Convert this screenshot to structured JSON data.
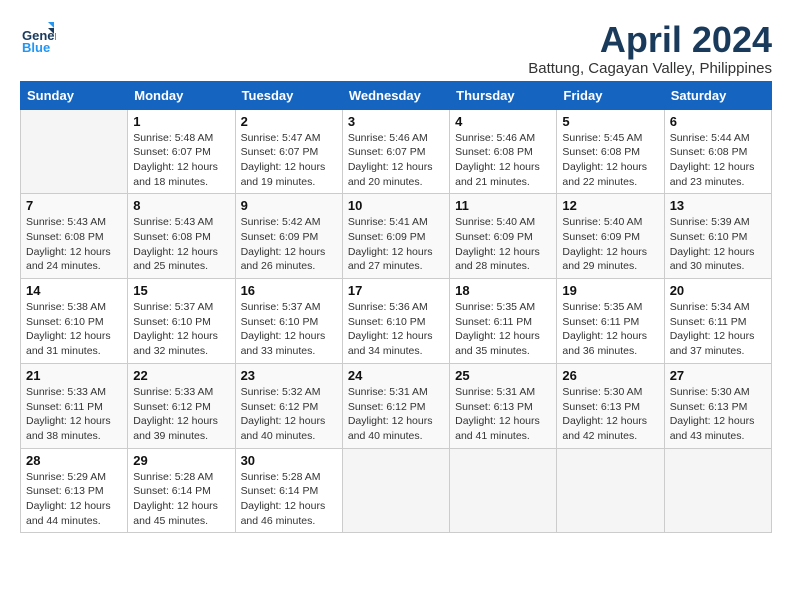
{
  "header": {
    "logo_general": "General",
    "logo_blue": "Blue",
    "month_title": "April 2024",
    "location": "Battung, Cagayan Valley, Philippines"
  },
  "days_of_week": [
    "Sunday",
    "Monday",
    "Tuesday",
    "Wednesday",
    "Thursday",
    "Friday",
    "Saturday"
  ],
  "weeks": [
    [
      {
        "day": "",
        "sunrise": "",
        "sunset": "",
        "daylight": ""
      },
      {
        "day": "1",
        "sunrise": "Sunrise: 5:48 AM",
        "sunset": "Sunset: 6:07 PM",
        "daylight": "Daylight: 12 hours and 18 minutes."
      },
      {
        "day": "2",
        "sunrise": "Sunrise: 5:47 AM",
        "sunset": "Sunset: 6:07 PM",
        "daylight": "Daylight: 12 hours and 19 minutes."
      },
      {
        "day": "3",
        "sunrise": "Sunrise: 5:46 AM",
        "sunset": "Sunset: 6:07 PM",
        "daylight": "Daylight: 12 hours and 20 minutes."
      },
      {
        "day": "4",
        "sunrise": "Sunrise: 5:46 AM",
        "sunset": "Sunset: 6:08 PM",
        "daylight": "Daylight: 12 hours and 21 minutes."
      },
      {
        "day": "5",
        "sunrise": "Sunrise: 5:45 AM",
        "sunset": "Sunset: 6:08 PM",
        "daylight": "Daylight: 12 hours and 22 minutes."
      },
      {
        "day": "6",
        "sunrise": "Sunrise: 5:44 AM",
        "sunset": "Sunset: 6:08 PM",
        "daylight": "Daylight: 12 hours and 23 minutes."
      }
    ],
    [
      {
        "day": "7",
        "sunrise": "Sunrise: 5:43 AM",
        "sunset": "Sunset: 6:08 PM",
        "daylight": "Daylight: 12 hours and 24 minutes."
      },
      {
        "day": "8",
        "sunrise": "Sunrise: 5:43 AM",
        "sunset": "Sunset: 6:08 PM",
        "daylight": "Daylight: 12 hours and 25 minutes."
      },
      {
        "day": "9",
        "sunrise": "Sunrise: 5:42 AM",
        "sunset": "Sunset: 6:09 PM",
        "daylight": "Daylight: 12 hours and 26 minutes."
      },
      {
        "day": "10",
        "sunrise": "Sunrise: 5:41 AM",
        "sunset": "Sunset: 6:09 PM",
        "daylight": "Daylight: 12 hours and 27 minutes."
      },
      {
        "day": "11",
        "sunrise": "Sunrise: 5:40 AM",
        "sunset": "Sunset: 6:09 PM",
        "daylight": "Daylight: 12 hours and 28 minutes."
      },
      {
        "day": "12",
        "sunrise": "Sunrise: 5:40 AM",
        "sunset": "Sunset: 6:09 PM",
        "daylight": "Daylight: 12 hours and 29 minutes."
      },
      {
        "day": "13",
        "sunrise": "Sunrise: 5:39 AM",
        "sunset": "Sunset: 6:10 PM",
        "daylight": "Daylight: 12 hours and 30 minutes."
      }
    ],
    [
      {
        "day": "14",
        "sunrise": "Sunrise: 5:38 AM",
        "sunset": "Sunset: 6:10 PM",
        "daylight": "Daylight: 12 hours and 31 minutes."
      },
      {
        "day": "15",
        "sunrise": "Sunrise: 5:37 AM",
        "sunset": "Sunset: 6:10 PM",
        "daylight": "Daylight: 12 hours and 32 minutes."
      },
      {
        "day": "16",
        "sunrise": "Sunrise: 5:37 AM",
        "sunset": "Sunset: 6:10 PM",
        "daylight": "Daylight: 12 hours and 33 minutes."
      },
      {
        "day": "17",
        "sunrise": "Sunrise: 5:36 AM",
        "sunset": "Sunset: 6:10 PM",
        "daylight": "Daylight: 12 hours and 34 minutes."
      },
      {
        "day": "18",
        "sunrise": "Sunrise: 5:35 AM",
        "sunset": "Sunset: 6:11 PM",
        "daylight": "Daylight: 12 hours and 35 minutes."
      },
      {
        "day": "19",
        "sunrise": "Sunrise: 5:35 AM",
        "sunset": "Sunset: 6:11 PM",
        "daylight": "Daylight: 12 hours and 36 minutes."
      },
      {
        "day": "20",
        "sunrise": "Sunrise: 5:34 AM",
        "sunset": "Sunset: 6:11 PM",
        "daylight": "Daylight: 12 hours and 37 minutes."
      }
    ],
    [
      {
        "day": "21",
        "sunrise": "Sunrise: 5:33 AM",
        "sunset": "Sunset: 6:11 PM",
        "daylight": "Daylight: 12 hours and 38 minutes."
      },
      {
        "day": "22",
        "sunrise": "Sunrise: 5:33 AM",
        "sunset": "Sunset: 6:12 PM",
        "daylight": "Daylight: 12 hours and 39 minutes."
      },
      {
        "day": "23",
        "sunrise": "Sunrise: 5:32 AM",
        "sunset": "Sunset: 6:12 PM",
        "daylight": "Daylight: 12 hours and 40 minutes."
      },
      {
        "day": "24",
        "sunrise": "Sunrise: 5:31 AM",
        "sunset": "Sunset: 6:12 PM",
        "daylight": "Daylight: 12 hours and 40 minutes."
      },
      {
        "day": "25",
        "sunrise": "Sunrise: 5:31 AM",
        "sunset": "Sunset: 6:13 PM",
        "daylight": "Daylight: 12 hours and 41 minutes."
      },
      {
        "day": "26",
        "sunrise": "Sunrise: 5:30 AM",
        "sunset": "Sunset: 6:13 PM",
        "daylight": "Daylight: 12 hours and 42 minutes."
      },
      {
        "day": "27",
        "sunrise": "Sunrise: 5:30 AM",
        "sunset": "Sunset: 6:13 PM",
        "daylight": "Daylight: 12 hours and 43 minutes."
      }
    ],
    [
      {
        "day": "28",
        "sunrise": "Sunrise: 5:29 AM",
        "sunset": "Sunset: 6:13 PM",
        "daylight": "Daylight: 12 hours and 44 minutes."
      },
      {
        "day": "29",
        "sunrise": "Sunrise: 5:28 AM",
        "sunset": "Sunset: 6:14 PM",
        "daylight": "Daylight: 12 hours and 45 minutes."
      },
      {
        "day": "30",
        "sunrise": "Sunrise: 5:28 AM",
        "sunset": "Sunset: 6:14 PM",
        "daylight": "Daylight: 12 hours and 46 minutes."
      },
      {
        "day": "",
        "sunrise": "",
        "sunset": "",
        "daylight": ""
      },
      {
        "day": "",
        "sunrise": "",
        "sunset": "",
        "daylight": ""
      },
      {
        "day": "",
        "sunrise": "",
        "sunset": "",
        "daylight": ""
      },
      {
        "day": "",
        "sunrise": "",
        "sunset": "",
        "daylight": ""
      }
    ]
  ]
}
